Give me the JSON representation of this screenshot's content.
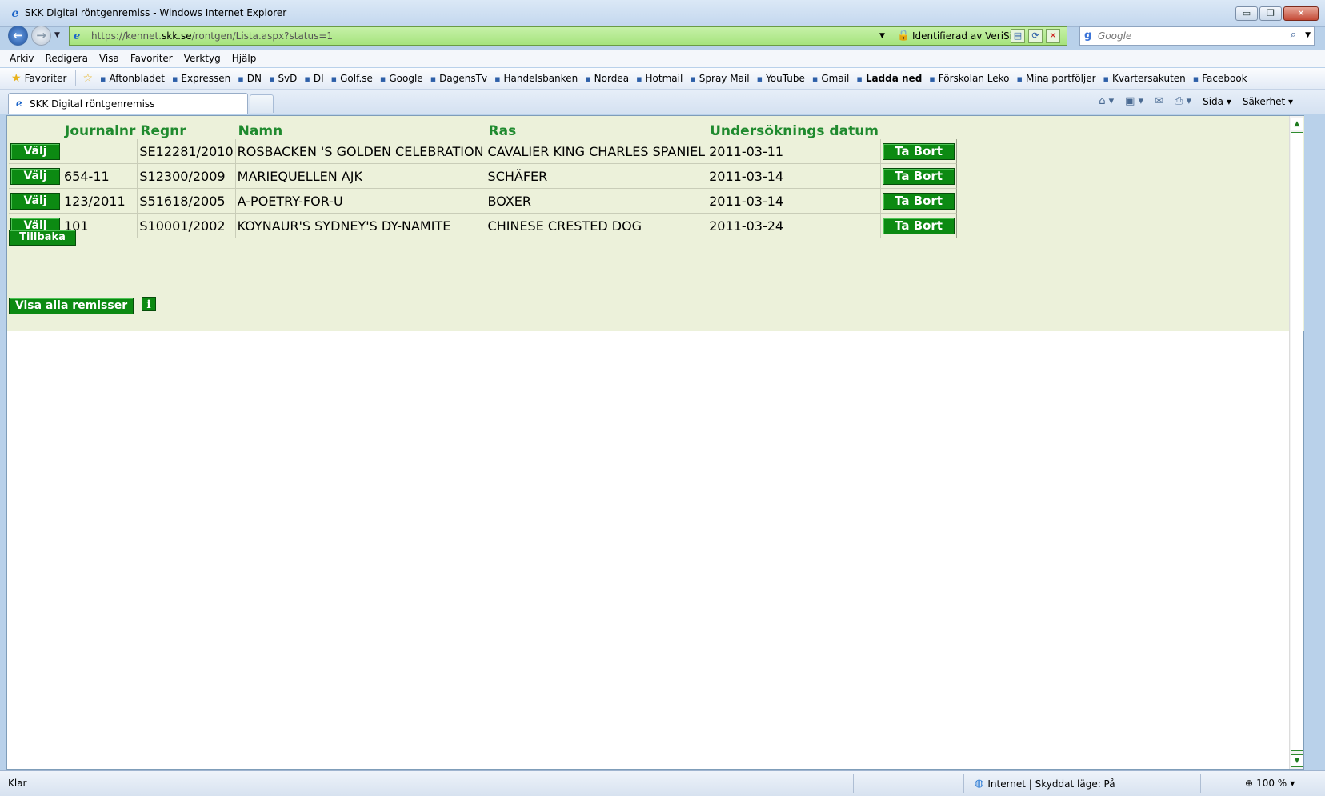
{
  "window": {
    "title": "SKK Digital röntgenremiss - Windows Internet Explorer",
    "min_label": "▭",
    "max_label": "❐",
    "close_label": "✕"
  },
  "nav": {
    "url_prefix": "https://kennet.",
    "url_domain": "skk.se",
    "url_suffix": "/rontgen/Lista.aspx?status=1",
    "identity": "Identifierad av VeriSign",
    "search_placeholder": "Google"
  },
  "menu": [
    "Arkiv",
    "Redigera",
    "Visa",
    "Favoriter",
    "Verktyg",
    "Hjälp"
  ],
  "favorites": {
    "main_label": "Favoriter",
    "items": [
      "Aftonbladet",
      "Expressen",
      "DN",
      "SvD",
      "DI",
      "Golf.se",
      "Google",
      "DagensTv",
      "Handelsbanken",
      "Nordea",
      "Hotmail",
      "Spray Mail",
      "YouTube",
      "Gmail",
      "Ladda ned",
      "Förskolan Leko",
      "Mina portföljer",
      "Kvartersakuten",
      "Facebook"
    ]
  },
  "tab": {
    "title": "SKK Digital röntgenremiss"
  },
  "commandbar": {
    "page_label": "Sida",
    "safety_label": "Säkerhet"
  },
  "table": {
    "headers": [
      "",
      "Journalnr",
      "Regnr",
      "Namn",
      "Ras",
      "Undersöknings datum",
      ""
    ],
    "select_label": "Välj",
    "remove_label": "Ta Bort",
    "rows": [
      {
        "journalnr": "",
        "regnr": "SE12281/2010",
        "namn": "ROSBACKEN 'S GOLDEN CELEBRATION",
        "ras": "CAVALIER KING CHARLES SPANIEL",
        "datum": "2011-03-11"
      },
      {
        "journalnr": "654-11",
        "regnr": "S12300/2009",
        "namn": "MARIEQUELLEN AJK",
        "ras": "SCHÄFER",
        "datum": "2011-03-14"
      },
      {
        "journalnr": "123/2011",
        "regnr": "S51618/2005",
        "namn": "A-POETRY-FOR-U",
        "ras": "BOXER",
        "datum": "2011-03-14"
      },
      {
        "journalnr": "101",
        "regnr": "S10001/2002",
        "namn": "KOYNAUR'S SYDNEY'S DY-NAMITE",
        "ras": "CHINESE CRESTED DOG",
        "datum": "2011-03-24"
      }
    ]
  },
  "buttons": {
    "back_label": "Tillbaka",
    "show_all_label": "Visa alla remisser",
    "info_label": "i"
  },
  "status": {
    "left": "Klar",
    "zone": "Internet | Skyddat läge: På",
    "zoom": "100 %"
  }
}
